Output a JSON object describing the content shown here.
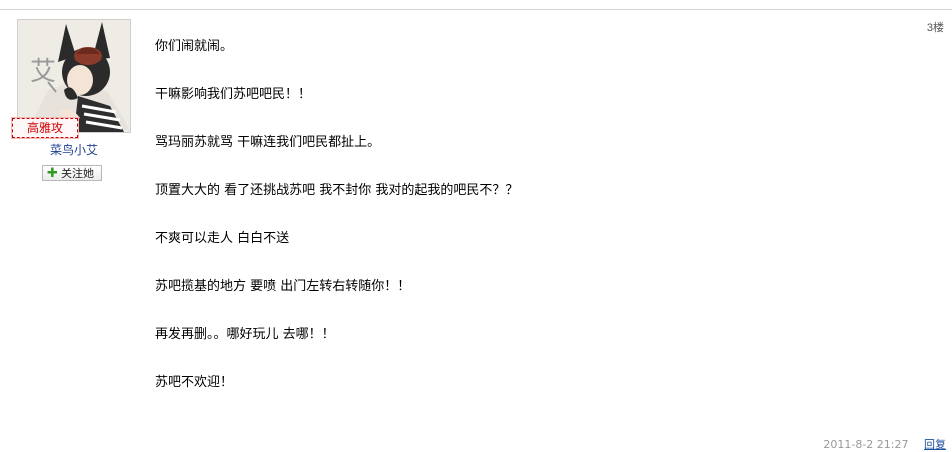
{
  "post": {
    "floor": "3楼",
    "author": {
      "name": "菜鸟小艾",
      "title_badge": "高雅攻",
      "avatar_char": "艾",
      "follow_label": "关注她"
    },
    "lines": [
      "你们闹就闹。",
      "干嘛影响我们苏吧吧民！！",
      "骂玛丽苏就骂 干嘛连我们吧民都扯上。",
      "顶置大大的 看了还挑战苏吧 我不封你 我对的起我的吧民不？？",
      "不爽可以走人 白白不送",
      "苏吧揽基的地方 要喷 出门左转右转随你！！",
      "再发再删。。哪好玩儿 去哪！！",
      "苏吧不欢迎！"
    ],
    "time": "2011-8-2 21:27",
    "reply_label": "回复"
  }
}
